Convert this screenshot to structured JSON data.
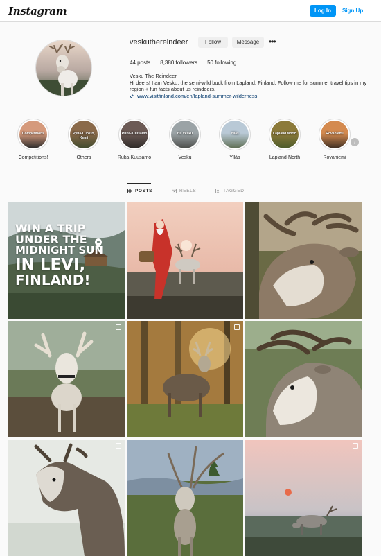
{
  "header": {
    "logo": "Instagram",
    "login_label": "Log In",
    "signup_label": "Sign Up"
  },
  "profile": {
    "username": "veskuthereindeer",
    "follow_label": "Follow",
    "message_label": "Message",
    "stats": {
      "posts": "44 posts",
      "followers": "8,380 followers",
      "following": "50 following"
    },
    "bio_name": "Vesku The Reindeer",
    "bio_text": "Hi deers! I am Vesku, the semi-wild buck from Lapland, Finland. Follow me for summer travel tips in my region + fun facts about us reindeers.",
    "bio_link": "www.visitfinland.com/en/lapland-summer-wilderness"
  },
  "highlights": [
    {
      "label": "Competitions!",
      "cover_text": "Competitions",
      "colors": [
        "#d59a7c",
        "#2a2a2a"
      ]
    },
    {
      "label": "Others",
      "cover_text": "Pyhä-Luosto, Kemi",
      "colors": [
        "#8a6a4a",
        "#3f4a2d"
      ]
    },
    {
      "label": "Ruka-Kuusamo",
      "cover_text": "Ruka-Kuusamo",
      "colors": [
        "#6c5a55",
        "#2e2a28"
      ]
    },
    {
      "label": "Vesku",
      "cover_text": "Hi, Vesku",
      "colors": [
        "#9ba3a6",
        "#4b4d4a"
      ]
    },
    {
      "label": "Ylläs",
      "cover_text": "Ylläs",
      "colors": [
        "#b9c9d6",
        "#5d6d52"
      ]
    },
    {
      "label": "Lapland-North",
      "cover_text": "Lapland North",
      "colors": [
        "#8c7a3a",
        "#4a5a2a"
      ]
    },
    {
      "label": "Rovaniemi",
      "cover_text": "Rovaniemi",
      "colors": [
        "#d48a4f",
        "#3d2e22"
      ]
    }
  ],
  "tabs": [
    {
      "label": "POSTS",
      "active": true
    },
    {
      "label": "REELS",
      "active": false
    },
    {
      "label": "TAGGED",
      "active": false
    }
  ],
  "posts": [
    {
      "overlay": [
        "WIN A TRIP",
        "UNDER THE",
        "MIDNIGHT SUN",
        "IN LEVI,",
        "FINLAND!"
      ],
      "multi": false
    },
    {
      "overlay": [],
      "multi": false
    },
    {
      "overlay": [],
      "multi": false
    },
    {
      "overlay": [],
      "multi": true
    },
    {
      "overlay": [],
      "multi": true
    },
    {
      "overlay": [],
      "multi": false
    },
    {
      "overlay": [],
      "multi": true
    },
    {
      "overlay": [],
      "multi": false
    },
    {
      "overlay": [],
      "multi": true
    }
  ],
  "icons": {
    "more": "more-options-icon",
    "link": "link-icon",
    "next": "chevron-right-icon",
    "posts_tab": "grid-icon",
    "reels_tab": "reels-icon",
    "tagged_tab": "tag-icon"
  }
}
